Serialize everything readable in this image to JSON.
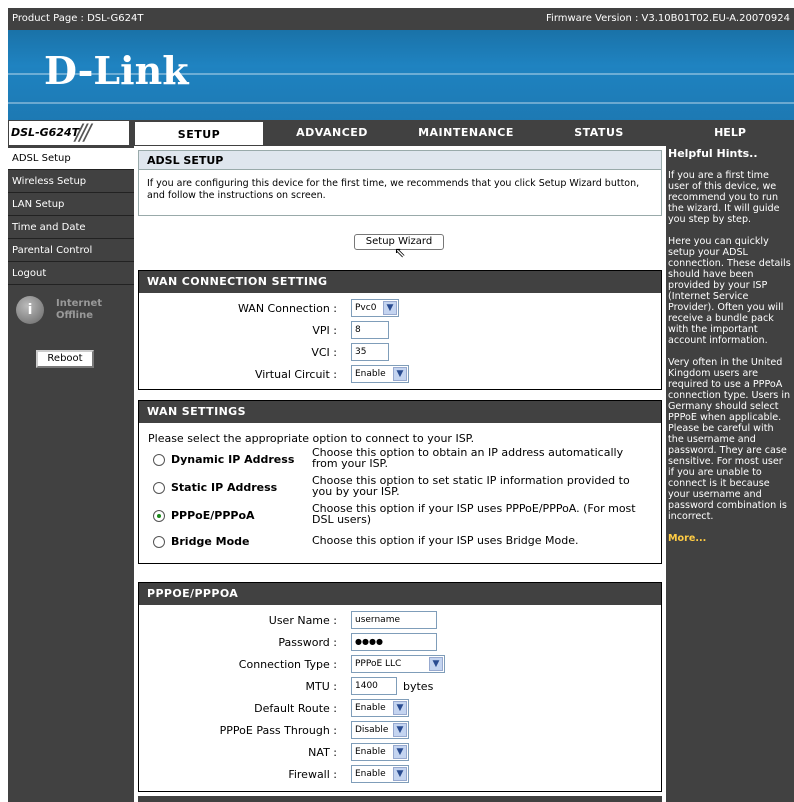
{
  "top_bar": {
    "product": "Product Page : DSL-G624T",
    "firmware": "Firmware Version : V3.10B01T02.EU-A.20070924"
  },
  "brand": {
    "logo": "D-Link",
    "accent": "#1f83c1"
  },
  "model": {
    "name": "DSL-G624T",
    "slashes": "///"
  },
  "nav": {
    "tabs": [
      "SETUP",
      "ADVANCED",
      "MAINTENANCE",
      "STATUS",
      "HELP"
    ],
    "active": "SETUP"
  },
  "sidebar": {
    "items": [
      "ADSL Setup",
      "Wireless Setup",
      "LAN Setup",
      "Time and Date",
      "Parental Control",
      "Logout"
    ],
    "active": "ADSL Setup",
    "internet_status": "Internet Offline",
    "reboot_label": "Reboot"
  },
  "intro": {
    "title": "ADSL SETUP",
    "text": "If you are configuring this device for the first time, we recommends that you click Setup Wizard button, and follow the instructions on screen.",
    "wizard_button": "Setup Wizard"
  },
  "wan_connection": {
    "title": "WAN CONNECTION SETTING",
    "wan_connection_label": "WAN Connection :",
    "wan_connection_value": "Pvc0",
    "vpi_label": "VPI :",
    "vpi_value": "8",
    "vci_label": "VCI :",
    "vci_value": "35",
    "virtual_circuit_label": "Virtual Circuit :",
    "virtual_circuit_value": "Enable"
  },
  "wan_settings": {
    "title": "WAN SETTINGS",
    "instruction": "Please select the appropriate option to connect to your ISP.",
    "options": [
      {
        "label": "Dynamic IP Address",
        "desc": "Choose this option to obtain an IP address automatically from your ISP.",
        "selected": false
      },
      {
        "label": "Static IP Address",
        "desc": "Choose this option to set static IP information provided to you by your ISP.",
        "selected": false
      },
      {
        "label": "PPPoE/PPPoA",
        "desc": "Choose this option if your ISP uses PPPoE/PPPoA. (For most DSL users)",
        "selected": true
      },
      {
        "label": "Bridge Mode",
        "desc": "Choose this option if your ISP uses Bridge Mode.",
        "selected": false
      }
    ]
  },
  "pppoe": {
    "title": "PPPOE/PPPOA",
    "username_label": "User Name :",
    "username_value": "username",
    "password_label": "Password :",
    "password_value": "●●●●",
    "conn_type_label": "Connection Type :",
    "conn_type_value": "PPPoE LLC",
    "mtu_label": "MTU :",
    "mtu_value": "1400",
    "mtu_unit": "bytes",
    "default_route_label": "Default Route :",
    "default_route_value": "Enable",
    "passthrough_label": "PPPoE Pass Through :",
    "passthrough_value": "Disable",
    "nat_label": "NAT :",
    "nat_value": "Enable",
    "firewall_label": "Firewall :",
    "firewall_value": "Enable"
  },
  "help": {
    "title": "Helpful Hints..",
    "paragraphs": [
      "If you are a first time user of this device, we recommend you to run the wizard. It will guide you step by step.",
      "Here you can quickly setup your ADSL connection. These details should have been provided by your ISP (Internet Service Provider). Often you will receive a bundle pack with the important account information.",
      "Very often in the United Kingdom users are required to use a PPPoA connection type. Users in Germany should select PPPoE when applicable. Please be careful with the username and password. They are case sensitive. For most user if you are unable to connect is it because your username and password combination is incorrect."
    ],
    "more": "More..."
  }
}
